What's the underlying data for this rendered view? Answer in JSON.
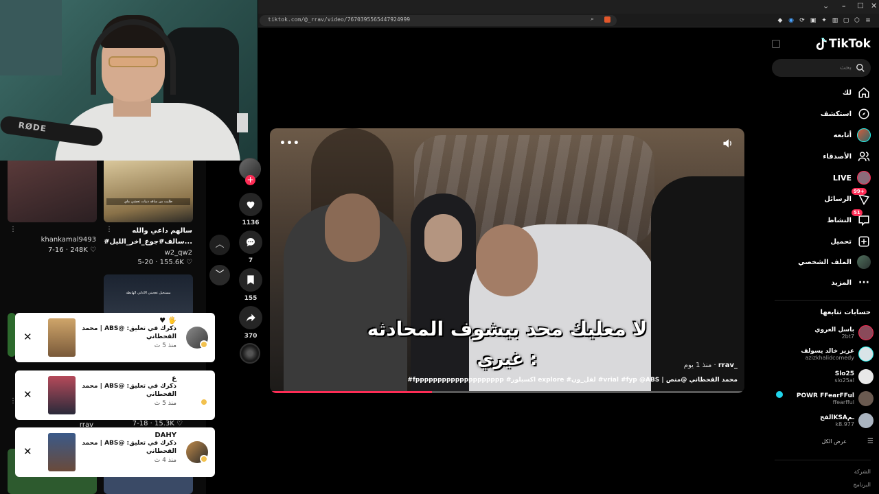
{
  "browser": {
    "url": "tiktok.com/@_rrav/video/7670395565447924999"
  },
  "webcam": {
    "mic_brand": "RØDE"
  },
  "feed": {
    "items": [
      {
        "author": "khankamal9493",
        "date": "7-16",
        "likes": "248K"
      },
      {
        "title_line1": "سالهم داعي والله",
        "title_line2": "#سالف#جوع_اخر_الليل...",
        "author": "w2_qw2",
        "date": "5-20",
        "likes": "155.6K",
        "caption": "طلبت من ساقه دبيات تحشي ماي"
      },
      {
        "caption": "مستحيل تعجبني الاغاني الهابطه"
      },
      {
        "author": "rrav",
        "date": "7-18",
        "likes": "15.3K"
      }
    ]
  },
  "rail": {
    "likes": "1136",
    "comments": "7",
    "saves": "155",
    "shares": "370"
  },
  "video": {
    "subtitle_line1": "لا معليك محد بيشوف المحادثه",
    "subtitle_line2": "غيري :",
    "author": "_rrav",
    "time": "منذ 1 يوم",
    "description": "#fpppppppppppppppppppp #اكسبلور explore #لفل_ون #vrial #fyp @ABS | محمد القحطاني @منص",
    "progress": 0.34
  },
  "sidebar": {
    "logo": "TikTok",
    "search_placeholder": "بحث",
    "nav": [
      {
        "label": "لك"
      },
      {
        "label": "استكشف"
      },
      {
        "label": "أتابعه"
      },
      {
        "label": "الأصدقاء"
      },
      {
        "label": "LIVE"
      },
      {
        "label": "الرسائل",
        "badge": "99+"
      },
      {
        "label": "النشاط",
        "badge": "51"
      },
      {
        "label": "تحميل"
      },
      {
        "label": "الملف الشخصي"
      },
      {
        "label": "المزيد"
      }
    ],
    "following_title": "حسابات تتابعها",
    "accounts": [
      {
        "name": "باسل العروي",
        "handle": "2bt7"
      },
      {
        "name": "عزيز خالد يسولف",
        "handle": "azizkhalidcomedy"
      },
      {
        "name": "Slo25",
        "handle": "slo25al"
      },
      {
        "name": "POWR FFearFFul",
        "handle": "ffearfful"
      },
      {
        "name": "الفخKSAـم",
        "handle": "k8.977"
      }
    ],
    "see_all": "عرض الكل",
    "footer": [
      "الشركة",
      "البرنامج"
    ]
  },
  "notifications": [
    {
      "title": "🖐 ♥",
      "body": "ذكرك في تعليق: @ABS | محمد القحطاني",
      "time": "منذ 5 ث"
    },
    {
      "title": "ع",
      "body": "ذكرك في تعليق: @ABS | محمد القحطاني",
      "time": "منذ 5 ث"
    },
    {
      "title": "DAHY",
      "body": "ذكرك في تعليق: @ABS | محمد القحطاني",
      "time": "منذ 4 ث"
    }
  ]
}
